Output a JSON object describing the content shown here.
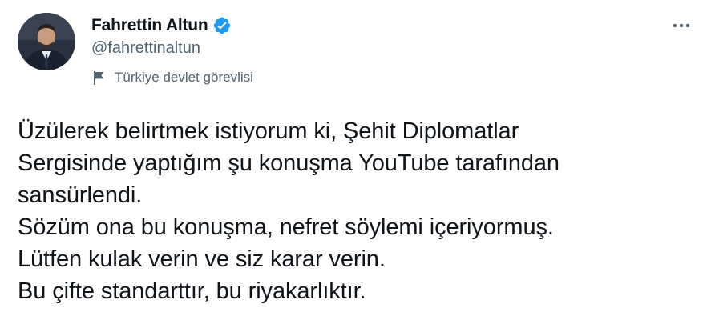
{
  "author": {
    "display_name": "Fahrettin Altun",
    "handle": "@fahrettinaltun",
    "verified": true,
    "label": "Türkiye devlet görevlisi"
  },
  "icons": {
    "verified": "verified-badge-icon",
    "label": "flag-icon",
    "more": "more-options-icon"
  },
  "colors": {
    "verified_blue": "#1d9bf0",
    "secondary_text": "#536471",
    "primary_text": "#0f1419"
  },
  "tweet": {
    "lines": [
      "Üzülerek belirtmek istiyorum ki, Şehit Diplomatlar",
      "Sergisinde yaptığım şu konuşma YouTube tarafından",
      "sansürlendi.",
      "Sözüm ona bu konuşma, nefret söylemi içeriyormuş.",
      "Lütfen kulak verin ve siz karar verin.",
      "Bu çifte standarttır, bu riyakarlıktır."
    ]
  }
}
